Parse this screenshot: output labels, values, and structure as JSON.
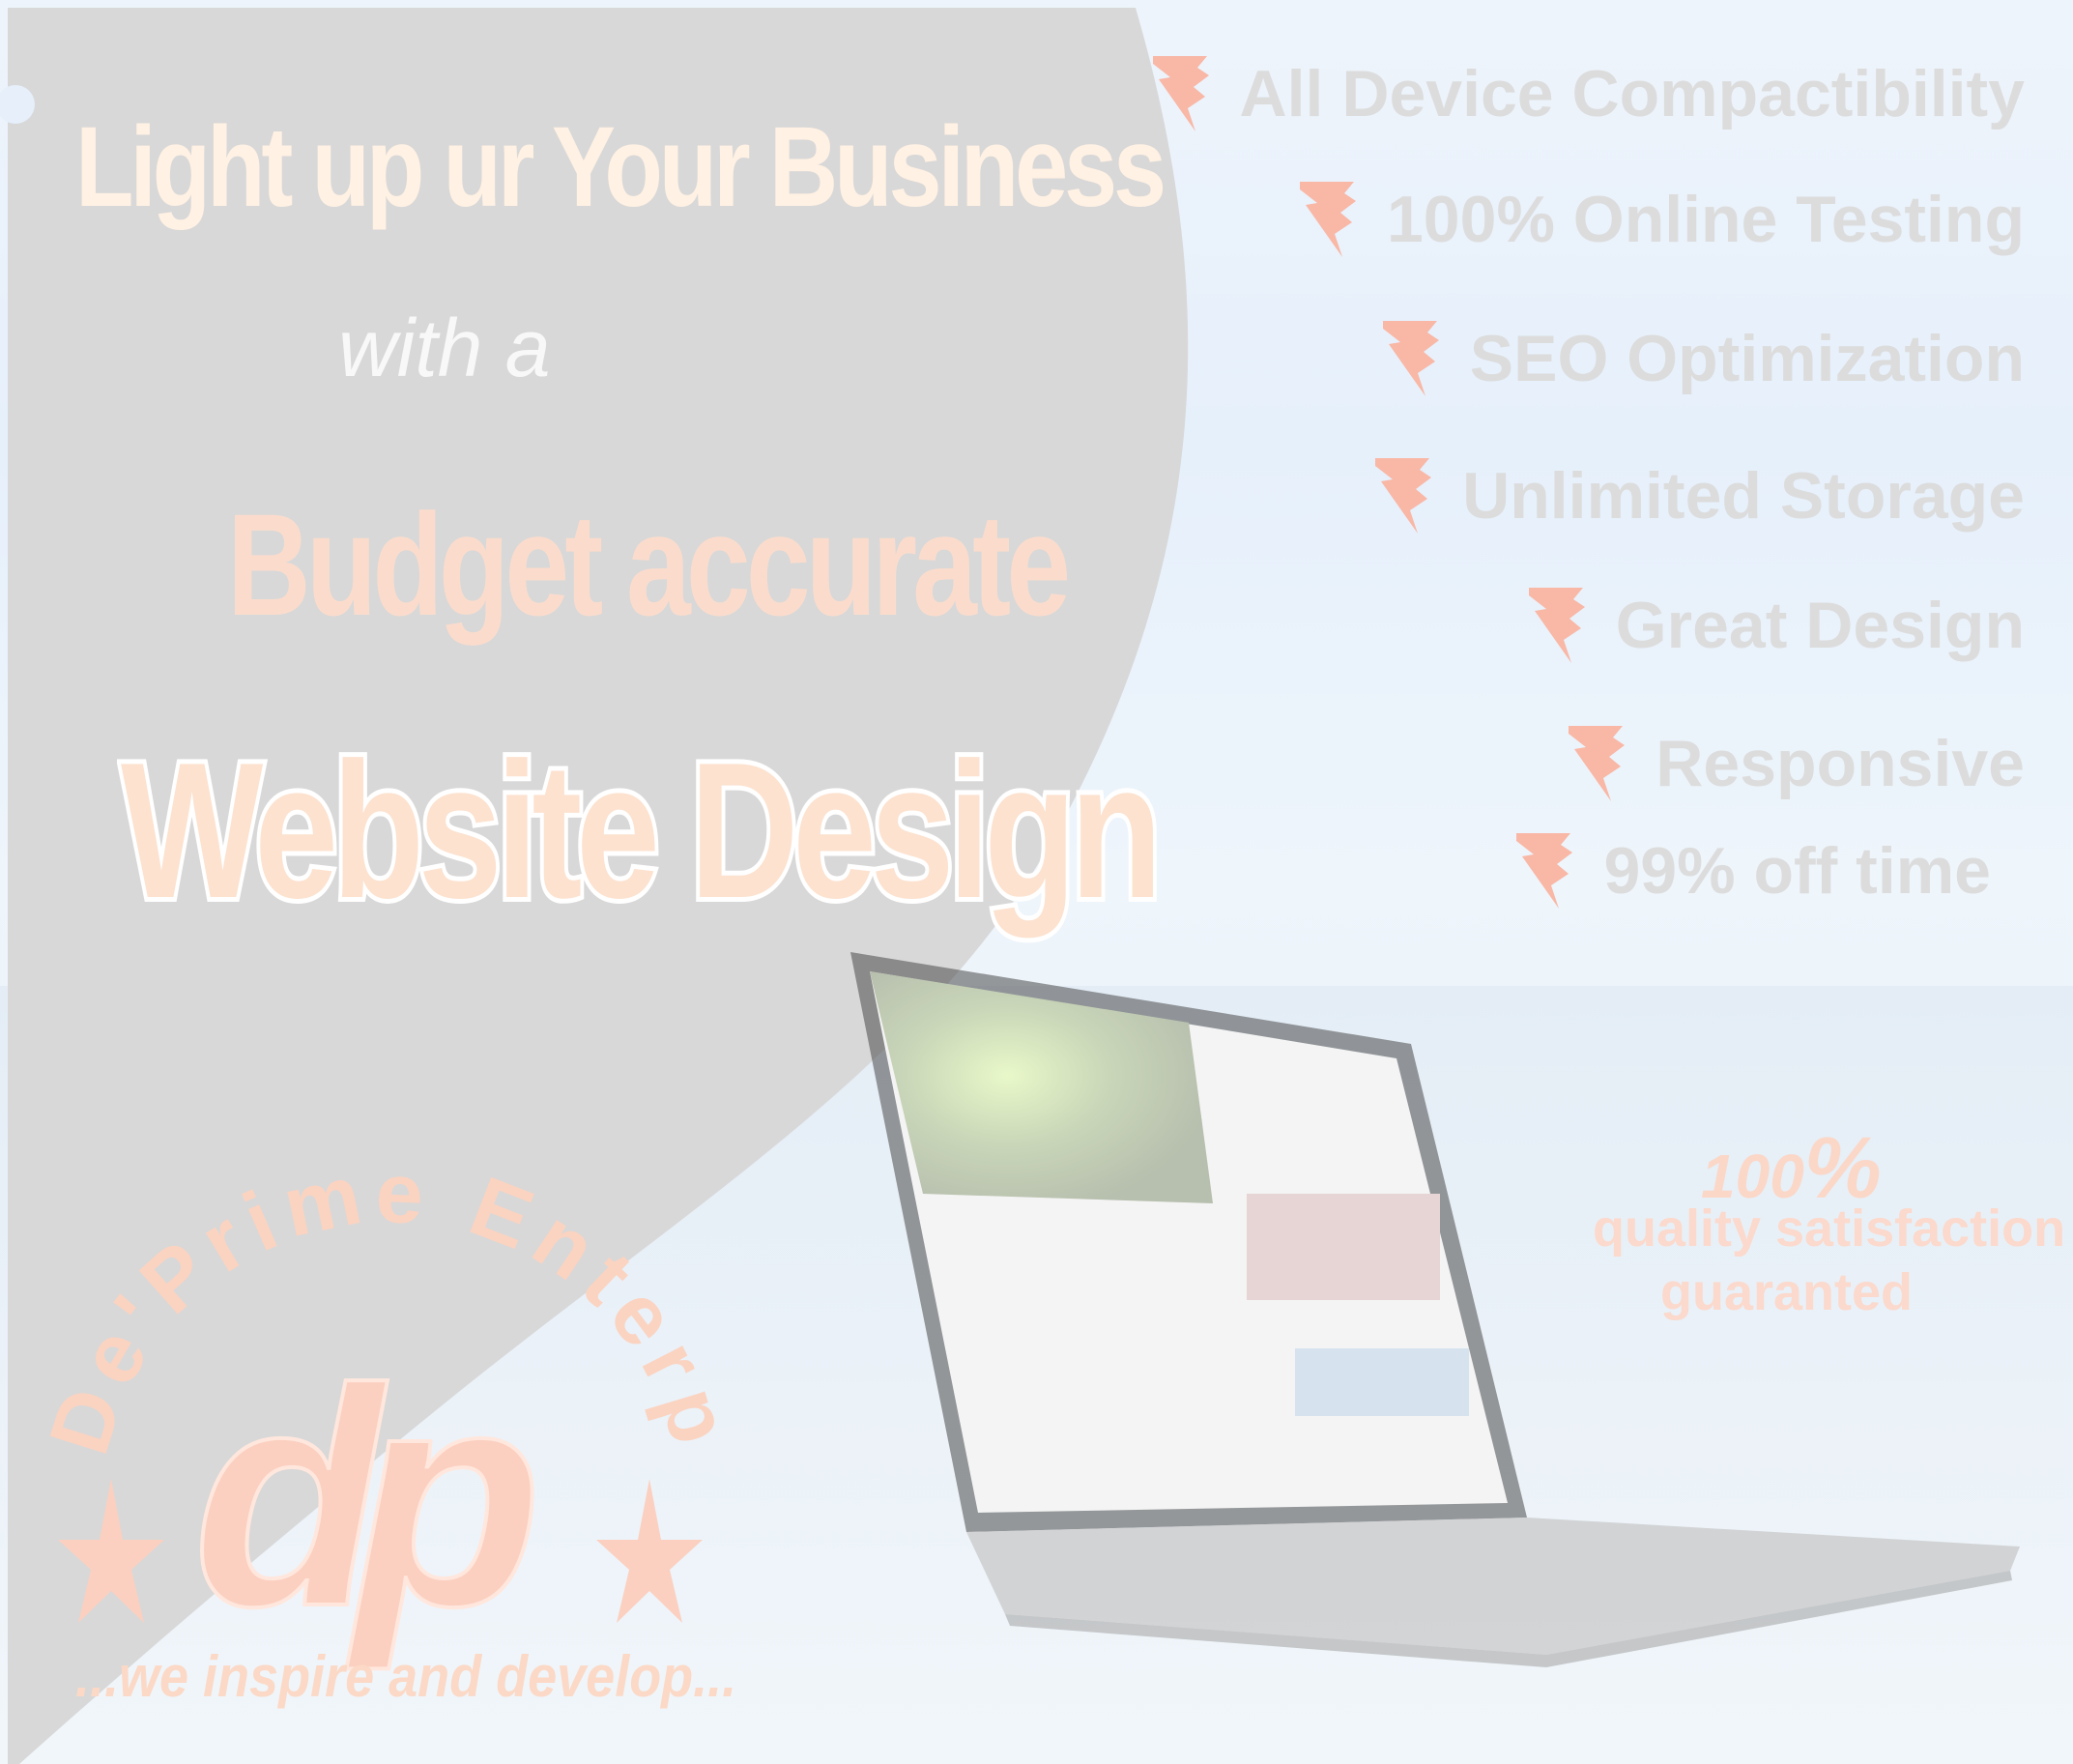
{
  "headline": {
    "line1": "Light up ur Your Business",
    "line2": "with a",
    "line3": "Budget accurate",
    "line4": "Website Design"
  },
  "features": [
    "All Device Compactibility",
    "100% Online Testing",
    "SEO Optimization",
    "Unlimited Storage",
    "Great Design",
    "Responsive",
    "99% off time"
  ],
  "guarantee": {
    "number": "100",
    "percent": "%",
    "line1": "quality satisfaction",
    "line2": "guaranted"
  },
  "logo": {
    "company_name": "De'Prime Enterprise",
    "monogram": "dp",
    "slogan": "...we inspire and develop..."
  },
  "colors": {
    "panel": "#d8d8d8",
    "accent": "#fbd5c4",
    "feature_text": "#dcdcdc"
  }
}
